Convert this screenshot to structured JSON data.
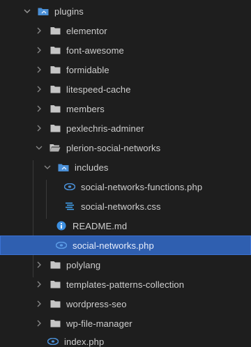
{
  "explorer": {
    "root": {
      "label": "plugins",
      "icon": "folder-open-icon",
      "expanded": true
    },
    "items": [
      {
        "label": "elementor",
        "icon": "folder-icon"
      },
      {
        "label": "font-awesome",
        "icon": "folder-icon"
      },
      {
        "label": "formidable",
        "icon": "folder-icon"
      },
      {
        "label": "litespeed-cache",
        "icon": "folder-icon"
      },
      {
        "label": "members",
        "icon": "folder-icon"
      },
      {
        "label": "pexlechris-adminer",
        "icon": "folder-icon"
      },
      {
        "label": "plerion-social-networks",
        "icon": "folder-open-icon",
        "expanded": true
      },
      {
        "label": "includes",
        "icon": "folder-open-icon",
        "expanded": true
      },
      {
        "label": "social-networks-functions.php",
        "icon": "php-file-icon"
      },
      {
        "label": "social-networks.css",
        "icon": "css-file-icon"
      },
      {
        "label": "README.md",
        "icon": "info-file-icon"
      },
      {
        "label": "social-networks.php",
        "icon": "php-file-icon",
        "selected": true
      },
      {
        "label": "polylang",
        "icon": "folder-icon"
      },
      {
        "label": "templates-patterns-collection",
        "icon": "folder-icon"
      },
      {
        "label": "wordpress-seo",
        "icon": "folder-icon"
      },
      {
        "label": "wp-file-manager",
        "icon": "folder-icon"
      },
      {
        "label": "index.php",
        "icon": "php-file-icon"
      }
    ]
  },
  "colors": {
    "background": "#1e1e1e",
    "selection": "#2f5fb0",
    "folder": "#c5c5c5",
    "root_folder": "#4a8fd6",
    "php_icon": "#4a8fd6",
    "css_icon": "#42a5f5",
    "info_icon": "#3d8fe0"
  }
}
